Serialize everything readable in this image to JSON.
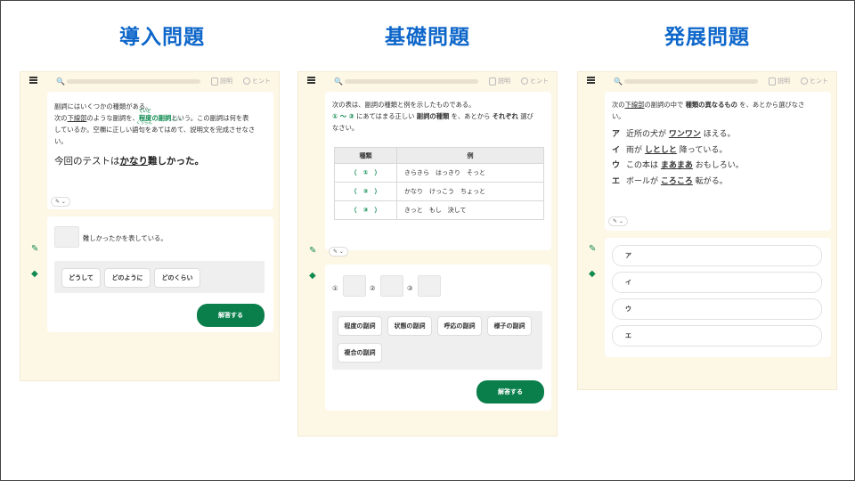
{
  "headings": [
    "導入問題",
    "基礎問題",
    "発展問題"
  ],
  "toolbar": {
    "search_glyph": "🔍",
    "explain": "説明",
    "hint": "ヒント"
  },
  "panel1": {
    "q_line1": "副詞にはいくつかの種類がある。",
    "q_line2_a": "次の",
    "q_line2_b": "下線部",
    "q_line2_c": "のような副詞を、",
    "q_line2_ruby1": "ていど",
    "q_line2_d": "程度の副詞",
    "q_line2_ruby2": "ふくし",
    "q_line2_e": "という。この副詞は何を表",
    "q_line3": "しているか。空欄に正しい語句をあてはめて、説明文を完成させなさ",
    "q_line3_ruby": "くうらん",
    "q_line4": "い。",
    "example_a": "今回のテストは",
    "example_b": "かなり",
    "example_c": "難しかった。",
    "edit_label": "✎ ⌄",
    "answer_suffix": "難しかったかを表している。",
    "options": [
      "どうして",
      "どのように",
      "どのくらい"
    ],
    "submit": "解答する"
  },
  "panel2": {
    "q_line1": "次の表は、副詞の種類と例を示したものである。",
    "q_line2_a": "① 〜 ③",
    "q_line2_b": "にあてはまる正しい",
    "q_line2_c": "副詞の種類",
    "q_line2_d": "を、あとから",
    "q_line2_e": "それぞれ",
    "q_line2_f": "選び",
    "q_line3": "なさい。",
    "table_headers": [
      "種類",
      "例"
    ],
    "table_rows": [
      {
        "kind": "（　①　）",
        "example": "きらきら　はっきり　そっと"
      },
      {
        "kind": "（　②　）",
        "example": "かなり　けっこう　ちょっと"
      },
      {
        "kind": "（　③　）",
        "example": "きっと　もし　決して"
      }
    ],
    "edit_label": "✎ ⌄",
    "blank_labels": [
      "①",
      "②",
      "③"
    ],
    "options": [
      "程度の副詞",
      "状態の副詞",
      "呼応の副詞",
      "様子の副詞",
      "複合の副詞"
    ],
    "submit": "解答する"
  },
  "panel3": {
    "q_line1_a": "次の",
    "q_line1_b": "下線部",
    "q_line1_c": "の副詞の中で",
    "q_line1_d": "種類の異なるもの",
    "q_line1_e": "を、あとから選びなさ",
    "q_line2": "い。",
    "sentences": [
      {
        "key": "ア",
        "pre": "近所の犬が",
        "adv": "ワンワン",
        "post": "ほえる。"
      },
      {
        "key": "イ",
        "pre": "雨が",
        "adv": "しとしと",
        "post": "降っている。"
      },
      {
        "key": "ウ",
        "pre": "この本は",
        "adv": "まあまあ",
        "post": "おもしろい。"
      },
      {
        "key": "エ",
        "pre": "ボールが",
        "adv": "ころころ",
        "post": "転がる。"
      }
    ],
    "edit_label": "✎ ⌄",
    "answers": [
      "ア",
      "イ",
      "ウ",
      "エ"
    ]
  },
  "colors": {
    "heading": "#0d66c9",
    "accent": "#0a7f4b",
    "panel_bg": "#fdf7e6"
  }
}
